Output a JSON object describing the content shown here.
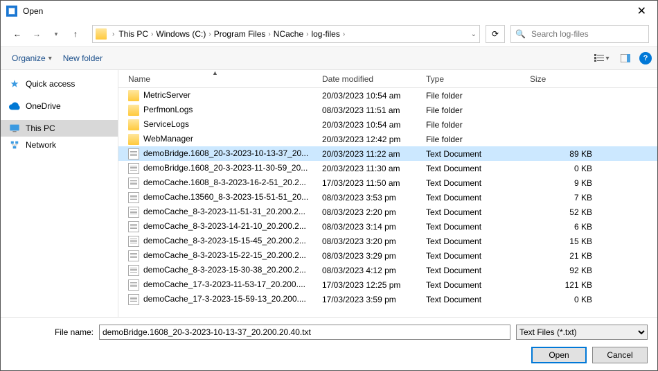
{
  "window": {
    "title": "Open"
  },
  "breadcrumb": [
    "This PC",
    "Windows (C:)",
    "Program Files",
    "NCache",
    "log-files"
  ],
  "search": {
    "placeholder": "Search log-files"
  },
  "toolbar": {
    "organize": "Organize",
    "newfolder": "New folder"
  },
  "sidebar": [
    {
      "label": "Quick access",
      "icon": "star",
      "color": "#3b9ae1"
    },
    {
      "label": "OneDrive",
      "icon": "cloud",
      "color": "#0078d4"
    },
    {
      "label": "This PC",
      "icon": "pc",
      "color": "#3b9ae1",
      "selected": true
    },
    {
      "label": "Network",
      "icon": "network",
      "color": "#3b9ae1"
    }
  ],
  "columns": {
    "name": "Name",
    "date": "Date modified",
    "type": "Type",
    "size": "Size"
  },
  "files": [
    {
      "name": "MetricServer",
      "date": "20/03/2023 10:54 am",
      "type": "File folder",
      "size": "",
      "kind": "folder"
    },
    {
      "name": "PerfmonLogs",
      "date": "08/03/2023 11:51 am",
      "type": "File folder",
      "size": "",
      "kind": "folder"
    },
    {
      "name": "ServiceLogs",
      "date": "20/03/2023 10:54 am",
      "type": "File folder",
      "size": "",
      "kind": "folder"
    },
    {
      "name": "WebManager",
      "date": "20/03/2023 12:42 pm",
      "type": "File folder",
      "size": "",
      "kind": "folder"
    },
    {
      "name": "demoBridge.1608_20-3-2023-10-13-37_20...",
      "date": "20/03/2023 11:22 am",
      "type": "Text Document",
      "size": "89 KB",
      "kind": "file",
      "selected": true
    },
    {
      "name": "demoBridge.1608_20-3-2023-11-30-59_20...",
      "date": "20/03/2023 11:30 am",
      "type": "Text Document",
      "size": "0 KB",
      "kind": "file"
    },
    {
      "name": "demoCache.1608_8-3-2023-16-2-51_20.2...",
      "date": "17/03/2023 11:50 am",
      "type": "Text Document",
      "size": "9 KB",
      "kind": "file"
    },
    {
      "name": "demoCache.13560_8-3-2023-15-51-51_20...",
      "date": "08/03/2023 3:53 pm",
      "type": "Text Document",
      "size": "7 KB",
      "kind": "file"
    },
    {
      "name": "demoCache_8-3-2023-11-51-31_20.200.2...",
      "date": "08/03/2023 2:20 pm",
      "type": "Text Document",
      "size": "52 KB",
      "kind": "file"
    },
    {
      "name": "demoCache_8-3-2023-14-21-10_20.200.2...",
      "date": "08/03/2023 3:14 pm",
      "type": "Text Document",
      "size": "6 KB",
      "kind": "file"
    },
    {
      "name": "demoCache_8-3-2023-15-15-45_20.200.2...",
      "date": "08/03/2023 3:20 pm",
      "type": "Text Document",
      "size": "15 KB",
      "kind": "file"
    },
    {
      "name": "demoCache_8-3-2023-15-22-15_20.200.2...",
      "date": "08/03/2023 3:29 pm",
      "type": "Text Document",
      "size": "21 KB",
      "kind": "file"
    },
    {
      "name": "demoCache_8-3-2023-15-30-38_20.200.2...",
      "date": "08/03/2023 4:12 pm",
      "type": "Text Document",
      "size": "92 KB",
      "kind": "file"
    },
    {
      "name": "demoCache_17-3-2023-11-53-17_20.200....",
      "date": "17/03/2023 12:25 pm",
      "type": "Text Document",
      "size": "121 KB",
      "kind": "file"
    },
    {
      "name": "demoCache_17-3-2023-15-59-13_20.200....",
      "date": "17/03/2023 3:59 pm",
      "type": "Text Document",
      "size": "0 KB",
      "kind": "file"
    }
  ],
  "filename": {
    "label": "File name:",
    "value": "demoBridge.1608_20-3-2023-10-13-37_20.200.20.40.txt"
  },
  "filter": {
    "selected": "Text Files (*.txt)"
  },
  "buttons": {
    "open": "Open",
    "cancel": "Cancel"
  }
}
